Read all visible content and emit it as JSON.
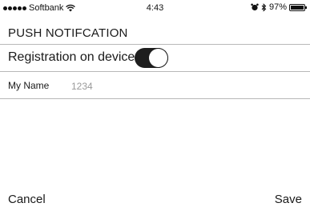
{
  "status_bar": {
    "carrier": "Softbank",
    "time": "4:43",
    "battery_percent": "97%",
    "battery_level": 0.97,
    "icons": [
      "signal-dots-icon",
      "wifi-icon",
      "alarm-icon",
      "bluetooth-icon",
      "battery-icon"
    ]
  },
  "header": {
    "title": "PUSH NOTIFCATION"
  },
  "registration": {
    "label": "Registration on device",
    "toggle_on": true
  },
  "name_field": {
    "label": "My Name",
    "placeholder": "1234"
  },
  "toolbar": {
    "cancel_label": "Cancel",
    "save_label": "Save"
  },
  "colors": {
    "toggle_on": "#1e1e1e",
    "divider": "#b8b8b8",
    "placeholder": "#9a9a9a"
  }
}
